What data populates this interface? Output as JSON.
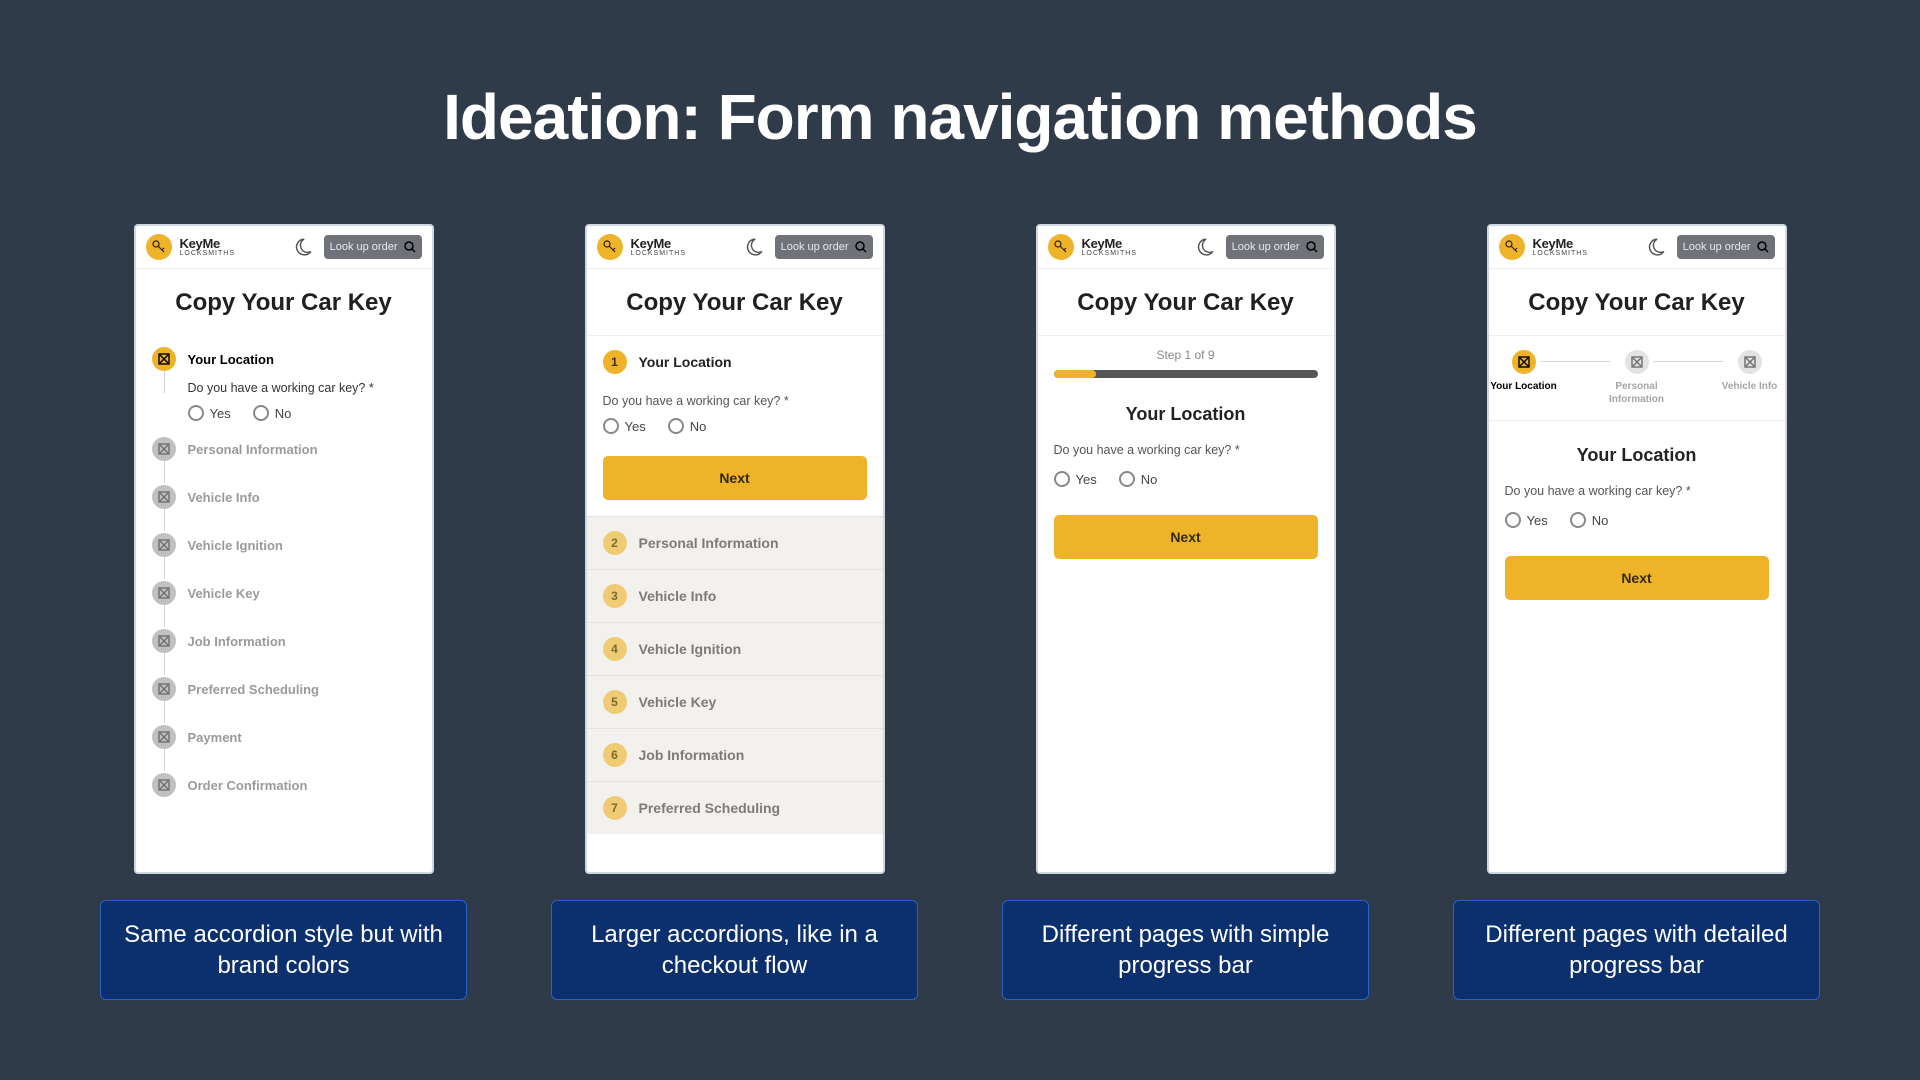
{
  "slide_title": "Ideation: Form navigation methods",
  "brand": {
    "name_top": "KeyMe",
    "name_bottom": "LOCKSMITHS"
  },
  "header": {
    "search_placeholder": "Look up order"
  },
  "page_title": "Copy Your Car Key",
  "question": "Do you have a working car key? *",
  "radios": {
    "yes": "Yes",
    "no": "No"
  },
  "next_label": "Next",
  "mock1": {
    "steps": [
      "Your Location",
      "Personal Information",
      "Vehicle Info",
      "Vehicle Ignition",
      "Vehicle Key",
      "Job Information",
      "Preferred Scheduling",
      "Payment",
      "Order Confirmation"
    ],
    "caption": "Same accordion style but with brand colors"
  },
  "mock2": {
    "active_step_number": "1",
    "active_step_label": "Your Location",
    "remaining": [
      {
        "n": "2",
        "label": "Personal Information"
      },
      {
        "n": "3",
        "label": "Vehicle Info"
      },
      {
        "n": "4",
        "label": "Vehicle Ignition"
      },
      {
        "n": "5",
        "label": "Vehicle Key"
      },
      {
        "n": "6",
        "label": "Job Information"
      },
      {
        "n": "7",
        "label": "Preferred Scheduling"
      }
    ],
    "caption": "Larger accordions, like in a checkout flow"
  },
  "mock3": {
    "step_indicator": "Step 1 of 9",
    "section_title": "Your Location",
    "caption": "Different pages with simple progress bar"
  },
  "mock4": {
    "steps": [
      {
        "label": "Your Location",
        "active": true
      },
      {
        "label": "Personal Information",
        "active": false
      },
      {
        "label": "Vehicle Info",
        "active": false
      }
    ],
    "section_title": "Your Location",
    "caption": "Different pages with detailed progress bar"
  }
}
